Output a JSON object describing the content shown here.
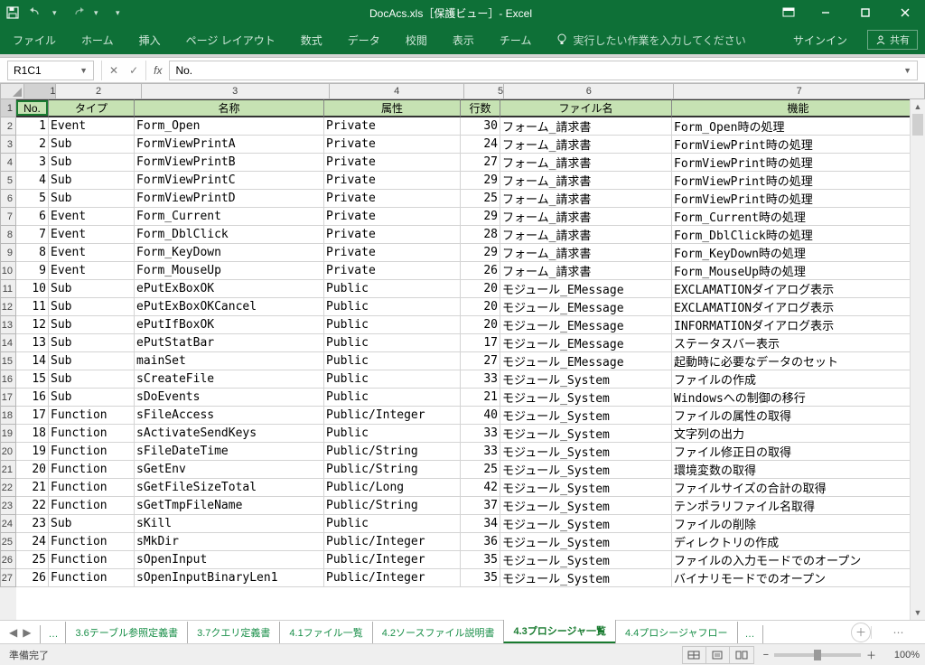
{
  "title": "DocAcs.xls［保護ビュー］- Excel",
  "ribbon": {
    "tabs": [
      "ファイル",
      "ホーム",
      "挿入",
      "ページ レイアウト",
      "数式",
      "データ",
      "校閲",
      "表示",
      "チーム"
    ],
    "tellme": "実行したい作業を入力してください",
    "signin": "サインイン",
    "share": "共有"
  },
  "namebox": "R1C1",
  "fx_value": "No.",
  "col_nums": [
    "1",
    "2",
    "3",
    "4",
    "5",
    "6",
    "7"
  ],
  "headers": [
    "No.",
    "タイプ",
    "名称",
    "属性",
    "行数",
    "ファイル名",
    "機能"
  ],
  "rows": [
    [
      "1",
      "Event",
      "Form_Open",
      "Private",
      "30",
      "フォーム_請求書",
      "Form_Open時の処理"
    ],
    [
      "2",
      "Sub",
      "FormViewPrintA",
      "Private",
      "24",
      "フォーム_請求書",
      "FormViewPrint時の処理"
    ],
    [
      "3",
      "Sub",
      "FormViewPrintB",
      "Private",
      "27",
      "フォーム_請求書",
      "FormViewPrint時の処理"
    ],
    [
      "4",
      "Sub",
      "FormViewPrintC",
      "Private",
      "29",
      "フォーム_請求書",
      "FormViewPrint時の処理"
    ],
    [
      "5",
      "Sub",
      "FormViewPrintD",
      "Private",
      "25",
      "フォーム_請求書",
      "FormViewPrint時の処理"
    ],
    [
      "6",
      "Event",
      "Form_Current",
      "Private",
      "29",
      "フォーム_請求書",
      "Form_Current時の処理"
    ],
    [
      "7",
      "Event",
      "Form_DblClick",
      "Private",
      "28",
      "フォーム_請求書",
      "Form_DblClick時の処理"
    ],
    [
      "8",
      "Event",
      "Form_KeyDown",
      "Private",
      "29",
      "フォーム_請求書",
      "Form_KeyDown時の処理"
    ],
    [
      "9",
      "Event",
      "Form_MouseUp",
      "Private",
      "26",
      "フォーム_請求書",
      "Form_MouseUp時の処理"
    ],
    [
      "10",
      "Sub",
      "ePutExBoxOK",
      "Public",
      "20",
      "モジュール_EMessage",
      "EXCLAMATIONダイアログ表示"
    ],
    [
      "11",
      "Sub",
      "ePutExBoxOKCancel",
      "Public",
      "20",
      "モジュール_EMessage",
      "EXCLAMATIONダイアログ表示"
    ],
    [
      "12",
      "Sub",
      "ePutIfBoxOK",
      "Public",
      "20",
      "モジュール_EMessage",
      "INFORMATIONダイアログ表示"
    ],
    [
      "13",
      "Sub",
      "ePutStatBar",
      "Public",
      "17",
      "モジュール_EMessage",
      "ステータスバー表示"
    ],
    [
      "14",
      "Sub",
      "mainSet",
      "Public",
      "27",
      "モジュール_EMessage",
      "起動時に必要なデータのセット"
    ],
    [
      "15",
      "Sub",
      "sCreateFile",
      "Public",
      "33",
      "モジュール_System",
      "ファイルの作成"
    ],
    [
      "16",
      "Sub",
      "sDoEvents",
      "Public",
      "21",
      "モジュール_System",
      "Windowsへの制御の移行"
    ],
    [
      "17",
      "Function",
      "sFileAccess",
      "Public/Integer",
      "40",
      "モジュール_System",
      "ファイルの属性の取得"
    ],
    [
      "18",
      "Function",
      "sActivateSendKeys",
      "Public",
      "33",
      "モジュール_System",
      "文字列の出力"
    ],
    [
      "19",
      "Function",
      "sFileDateTime",
      "Public/String",
      "33",
      "モジュール_System",
      "ファイル修正日の取得"
    ],
    [
      "20",
      "Function",
      "sGetEnv",
      "Public/String",
      "25",
      "モジュール_System",
      "環境変数の取得"
    ],
    [
      "21",
      "Function",
      "sGetFileSizeTotal",
      "Public/Long",
      "42",
      "モジュール_System",
      "ファイルサイズの合計の取得"
    ],
    [
      "22",
      "Function",
      "sGetTmpFileName",
      "Public/String",
      "37",
      "モジュール_System",
      "テンポラリファイル名取得"
    ],
    [
      "23",
      "Sub",
      "sKill",
      "Public",
      "34",
      "モジュール_System",
      "ファイルの削除"
    ],
    [
      "24",
      "Function",
      "sMkDir",
      "Public/Integer",
      "36",
      "モジュール_System",
      "ディレクトリの作成"
    ],
    [
      "25",
      "Function",
      "sOpenInput",
      "Public/Integer",
      "35",
      "モジュール_System",
      "ファイルの入力モードでのオープン"
    ],
    [
      "26",
      "Function",
      "sOpenInputBinaryLen1",
      "Public/Integer",
      "35",
      "モジュール_System",
      "バイナリモードでのオープン"
    ]
  ],
  "sheet_tabs": {
    "dots": "…",
    "items": [
      "3.6テーブル参照定義書",
      "3.7クエリ定義書",
      "4.1ファイル一覧",
      "4.2ソースファイル説明書",
      "4.3プロシージャ一覧",
      "4.4プロシージャフロー"
    ],
    "end_dots": "…",
    "active": 4
  },
  "status": {
    "left": "準備完了",
    "zoom": "100%"
  }
}
